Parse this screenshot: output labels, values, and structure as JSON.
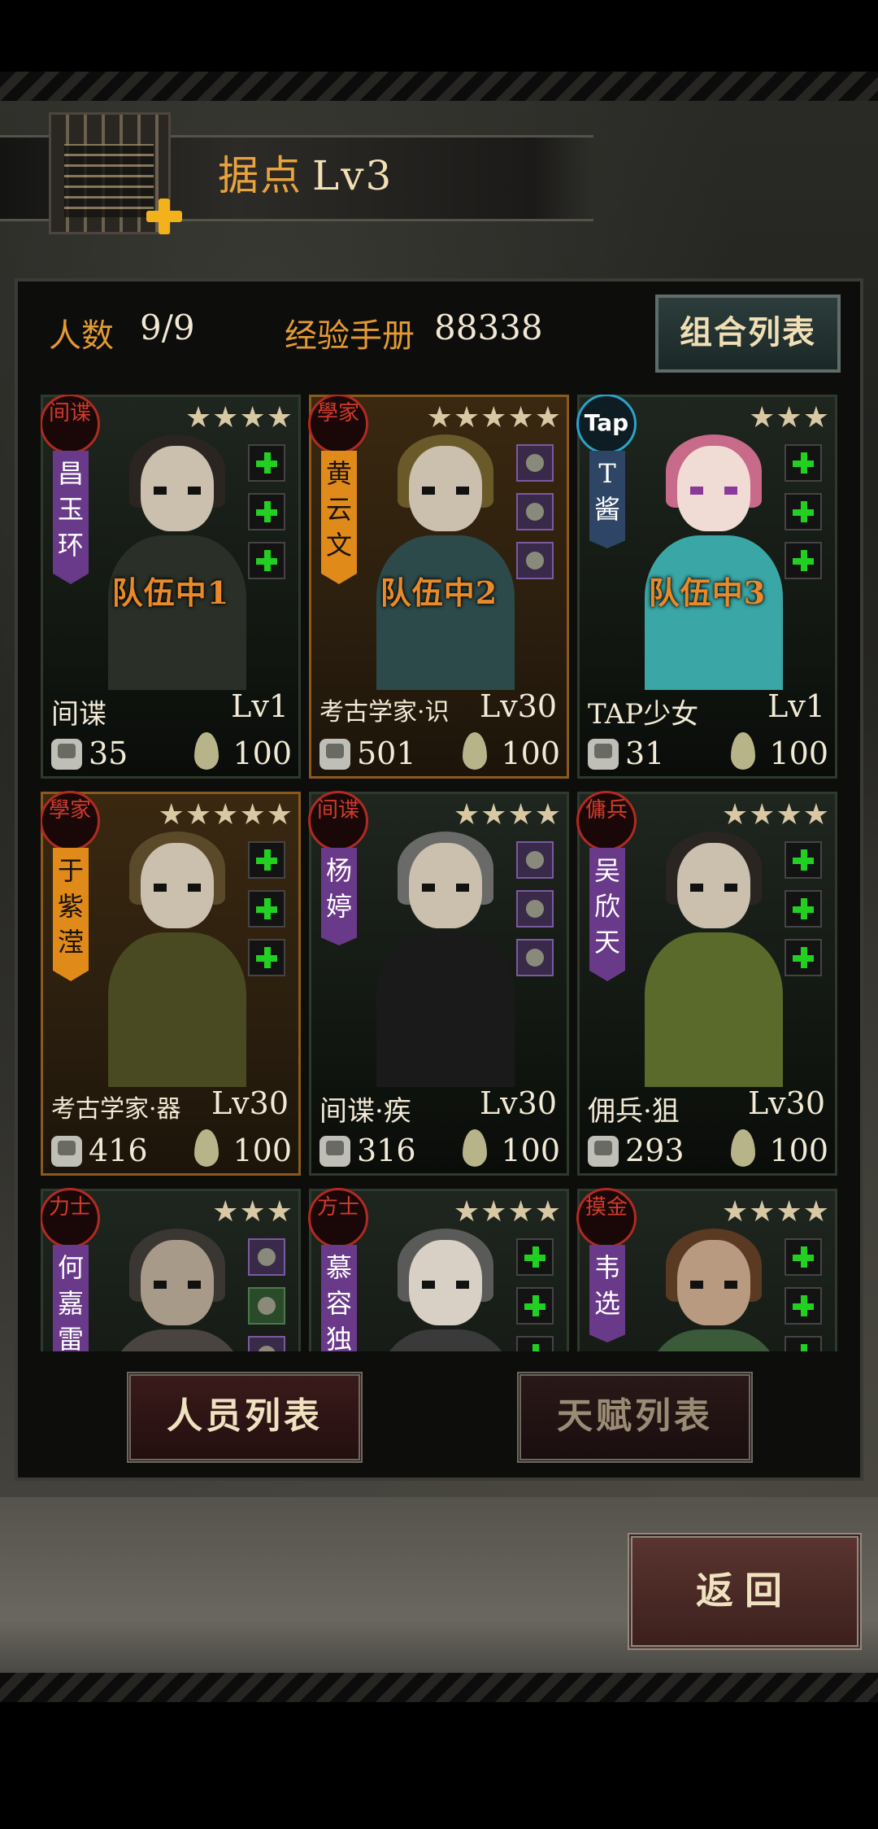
{
  "header": {
    "title": "据点",
    "level": "Lv3"
  },
  "stats": {
    "count_label": "人数",
    "count_value": "9/9",
    "exp_label": "经验手册",
    "exp_value": "88338",
    "combo_button": "组合列表"
  },
  "cards": [
    {
      "badge": "间谍",
      "stars": "★★★★",
      "name": "昌玉环",
      "team": "队伍中1",
      "job": "间谍",
      "level": "Lv1",
      "power": "35",
      "stamina": "100"
    },
    {
      "badge": "學家",
      "stars": "★★★★★",
      "name": "黄云文",
      "team": "队伍中2",
      "job": "考古学家·识",
      "level": "Lv30",
      "power": "501",
      "stamina": "100"
    },
    {
      "badge": "Tap",
      "stars": "★★★",
      "name": "T酱",
      "team": "队伍中3",
      "job": "TAP少女",
      "level": "Lv1",
      "power": "31",
      "stamina": "100"
    },
    {
      "badge": "學家",
      "stars": "★★★★★",
      "name": "于紫滢",
      "team": "",
      "job": "考古学家·器",
      "level": "Lv30",
      "power": "416",
      "stamina": "100"
    },
    {
      "badge": "间谍",
      "stars": "★★★★",
      "name": "杨婷",
      "team": "",
      "job": "间谍·疾",
      "level": "Lv30",
      "power": "316",
      "stamina": "100"
    },
    {
      "badge": "傭兵",
      "stars": "★★★★",
      "name": "吴欣天",
      "team": "",
      "job": "佣兵·狙",
      "level": "Lv30",
      "power": "293",
      "stamina": "100"
    },
    {
      "badge": "力士",
      "stars": "★★★",
      "name": "何嘉雷",
      "team": "",
      "job": "",
      "level": "",
      "power": "",
      "stamina": ""
    },
    {
      "badge": "方士",
      "stars": "★★★★",
      "name": "慕容独",
      "team": "",
      "job": "",
      "level": "",
      "power": "",
      "stamina": ""
    },
    {
      "badge": "摸金",
      "stars": "★★★★",
      "name": "韦选",
      "team": "",
      "job": "",
      "level": "",
      "power": "",
      "stamina": ""
    }
  ],
  "tabs": {
    "staff_list": "人员列表",
    "talent_list": "天赋列表"
  },
  "back_button": "返回"
}
